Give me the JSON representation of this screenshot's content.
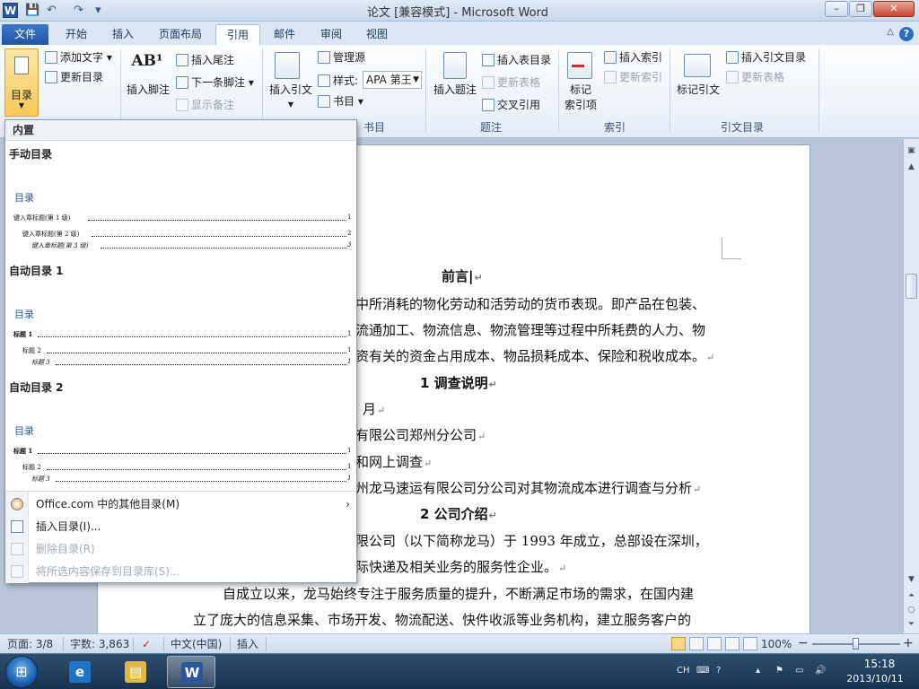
{
  "app": {
    "title": "论文 [兼容模式] - Microsoft Word",
    "logo_letter": "W",
    "qat": [
      "💾",
      "↶",
      "↷",
      "▾"
    ],
    "window_buttons": [
      "–",
      "❐",
      "✕"
    ]
  },
  "tabs": [
    "文件",
    "开始",
    "插入",
    "页面布局",
    "引用",
    "邮件",
    "审阅",
    "视图"
  ],
  "active_tab": "引用",
  "help_glyph": "?",
  "minimize_ribbon_glyph": "△",
  "ribbon": {
    "toc": {
      "toc_button": "目录",
      "add_text": "添加文字",
      "update_toc": "更新目录"
    },
    "footnotes": {
      "insert_footnote": "插入脚注",
      "insert_endnote": "插入尾注",
      "next_footnote": "下一条脚注",
      "show_notes": "显示备注",
      "icon_text": "AB¹"
    },
    "citations": {
      "insert_citation": "插入引文",
      "manage_sources": "管理源",
      "style_label": "样式:",
      "style_value": "APA 第王",
      "bibliography": "书目",
      "group_label": "书目"
    },
    "captions": {
      "insert_caption": "插入题注",
      "insert_table_of_figures": "插入表目录",
      "update_table": "更新表格",
      "cross_reference": "交叉引用",
      "group_label": "题注"
    },
    "index": {
      "mark_entry_line1": "标记",
      "mark_entry_line2": "索引项",
      "insert_index": "插入索引",
      "update_index": "更新索引",
      "group_label": "索引"
    },
    "authorities": {
      "mark_citation": "标记引文",
      "insert_table_of_authorities": "插入引文目录",
      "update_table": "更新表格",
      "group_label": "引文目录"
    }
  },
  "toc_menu": {
    "header": "内置",
    "galleries": [
      {
        "title": "手动目录",
        "heading": "目录",
        "lines": [
          {
            "text": "键入章标题(第 1 级)",
            "page": "1"
          },
          {
            "text": "键入章标题(第 2 级)",
            "page": "2"
          },
          {
            "text": "键入章标题(第 3 级)",
            "page": "3"
          }
        ]
      },
      {
        "title": "自动目录 1",
        "heading": "目录",
        "lines": [
          {
            "text": "标题 1",
            "page": "1"
          },
          {
            "text": "标题 2",
            "page": "1"
          },
          {
            "text": "标题 3",
            "page": "1"
          }
        ]
      },
      {
        "title": "自动目录 2",
        "heading": "目录",
        "lines": [
          {
            "text": "标题 1",
            "page": "1"
          },
          {
            "text": "标题 2",
            "page": "1"
          },
          {
            "text": "标题 3",
            "page": "1"
          }
        ]
      }
    ],
    "items": [
      {
        "label": "Office.com 中的其他目录(M)",
        "enabled": true,
        "submenu": "›"
      },
      {
        "label": "插入目录(I)...",
        "enabled": true
      },
      {
        "label": "删除目录(R)",
        "enabled": false
      },
      {
        "label": "将所选内容保存到目录库(S)...",
        "enabled": false
      }
    ]
  },
  "document": {
    "heading_preface": "前言",
    "line1": "中所消耗的物化劳动和活劳动的货币表现。即产品在包装、",
    "line2": "流通加工、物流信息、物流管理等过程中所耗费的人力、物",
    "line3": "资有关的资金占用成本、物品损耗成本、保险和税收成本。",
    "heading1": "1  调查说明",
    "line4": "月",
    "line5": "有限公司郑州分公司",
    "line6": "和网上调查",
    "line7": "州龙马速运有限公司分公司对其物流成本进行调查与分析",
    "heading2": "2  公司介绍",
    "line8": "限公司（以下简称龙马）于  1993  年成立，总部设在深圳，",
    "line9": "际快递及相关业务的服务性企业。",
    "line10": "自成立以来，龙马始终专注于服务质量的提升，不断满足市场的需求，在国内建",
    "line11": "立了庞大的信息采集、市场开发、物流配送、快件收派等业务机构，建立服务客户的",
    "para_mark": "↵"
  },
  "statusbar": {
    "page": "页面: 3/8",
    "words": "字数: 3,863",
    "language": "中文(中国)",
    "mode": "插入",
    "zoom": "100%",
    "zoom_level": 0.5,
    "zoom_minus": "−",
    "zoom_plus": "+"
  },
  "taskbar": {
    "start_glyph": "⊞",
    "ime": "CH",
    "tray_icons": [
      "⌨",
      "?",
      "▴",
      "⚑",
      "▭",
      "🔊"
    ],
    "time": "15:18",
    "date": "2013/10/11",
    "apps": [
      {
        "name": "ie",
        "glyph": "e",
        "color": "#1f73c9"
      },
      {
        "name": "explorer",
        "glyph": "▤",
        "color": "#e3b648"
      },
      {
        "name": "word",
        "glyph": "W",
        "color": "#2b579a"
      }
    ]
  },
  "colors": {
    "file_tab": "#2155a5",
    "accent": "#2b579a",
    "toc_link": "#2e5aa0"
  }
}
